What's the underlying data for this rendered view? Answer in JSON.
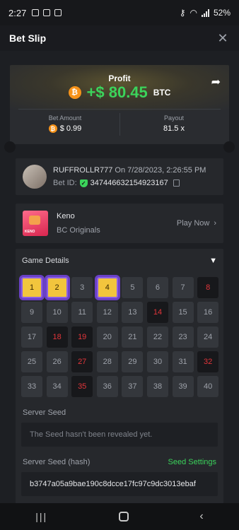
{
  "status_bar": {
    "time": "2:27",
    "battery": "52%"
  },
  "header": {
    "title": "Bet Slip",
    "close_icon": "close-icon"
  },
  "profit": {
    "label": "Profit",
    "value": "+$ 80.45",
    "currency": "BTC"
  },
  "bet_amount": {
    "label": "Bet Amount",
    "value": "$ 0.99"
  },
  "payout": {
    "label": "Payout",
    "value": "81.5 x"
  },
  "bettor": {
    "username": "RUFFROLLR777",
    "date": "On 7/28/2023, 2:26:55 PM",
    "bet_id_label": "Bet ID:",
    "bet_id": "347446632154923167"
  },
  "game": {
    "name": "Keno",
    "provider": "BC Originals",
    "play_label": "Play Now",
    "thumb_tag": "KENO"
  },
  "details": {
    "title": "Game Details",
    "cells": [
      {
        "n": "1",
        "s": "hit"
      },
      {
        "n": "2",
        "s": "hit"
      },
      {
        "n": "3",
        "s": ""
      },
      {
        "n": "4",
        "s": "hit"
      },
      {
        "n": "5",
        "s": ""
      },
      {
        "n": "6",
        "s": ""
      },
      {
        "n": "7",
        "s": ""
      },
      {
        "n": "8",
        "s": "miss"
      },
      {
        "n": "9",
        "s": ""
      },
      {
        "n": "10",
        "s": ""
      },
      {
        "n": "11",
        "s": ""
      },
      {
        "n": "12",
        "s": ""
      },
      {
        "n": "13",
        "s": ""
      },
      {
        "n": "14",
        "s": "miss"
      },
      {
        "n": "15",
        "s": ""
      },
      {
        "n": "16",
        "s": ""
      },
      {
        "n": "17",
        "s": ""
      },
      {
        "n": "18",
        "s": "miss"
      },
      {
        "n": "19",
        "s": "miss"
      },
      {
        "n": "20",
        "s": ""
      },
      {
        "n": "21",
        "s": ""
      },
      {
        "n": "22",
        "s": ""
      },
      {
        "n": "23",
        "s": ""
      },
      {
        "n": "24",
        "s": ""
      },
      {
        "n": "25",
        "s": ""
      },
      {
        "n": "26",
        "s": ""
      },
      {
        "n": "27",
        "s": "miss"
      },
      {
        "n": "28",
        "s": ""
      },
      {
        "n": "29",
        "s": ""
      },
      {
        "n": "30",
        "s": ""
      },
      {
        "n": "31",
        "s": ""
      },
      {
        "n": "32",
        "s": "miss"
      },
      {
        "n": "33",
        "s": ""
      },
      {
        "n": "34",
        "s": ""
      },
      {
        "n": "35",
        "s": "miss"
      },
      {
        "n": "36",
        "s": ""
      },
      {
        "n": "37",
        "s": ""
      },
      {
        "n": "38",
        "s": ""
      },
      {
        "n": "39",
        "s": ""
      },
      {
        "n": "40",
        "s": ""
      }
    ],
    "server_seed_label": "Server Seed",
    "server_seed_placeholder": "The Seed hasn't been revealed yet.",
    "server_seed_hash_label": "Server Seed (hash)",
    "seed_settings_label": "Seed Settings",
    "server_seed_hash": "b3747a05a9bae190c8dcce17fc97c9dc3013ebaf"
  },
  "colors": {
    "accent_green": "#3bd35b",
    "miss_red": "#e2353a",
    "hit_gold": "#f2c53d",
    "hit_outline": "#6a40c7"
  }
}
